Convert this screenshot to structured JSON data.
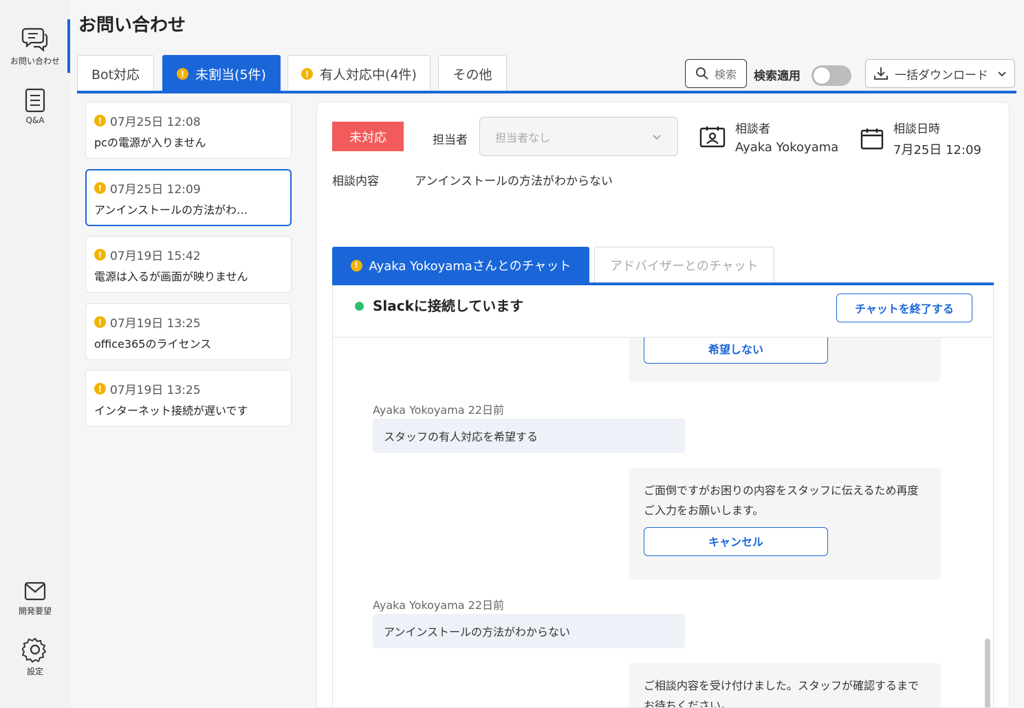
{
  "rail": {
    "items": [
      {
        "label": "お問い合わせ",
        "icon": "chat-bubbles-icon"
      },
      {
        "label": "Q&A",
        "icon": "document-list-icon"
      },
      {
        "label": "開発要望",
        "icon": "mail-icon"
      },
      {
        "label": "設定",
        "icon": "gear-icon"
      }
    ]
  },
  "page": {
    "title": "お問い合わせ"
  },
  "tabs": [
    {
      "label": "Bot対応"
    },
    {
      "label": "未割当(5件)"
    },
    {
      "label": "有人対応中(4件)"
    },
    {
      "label": "その他"
    }
  ],
  "toolbar": {
    "search_label": "検索",
    "search_apply_label": "検索適用",
    "download_label": "一括ダウンロード"
  },
  "inquiries": [
    {
      "time": "07月25日 12:08",
      "title": "pcの電源が入りません"
    },
    {
      "time": "07月25日 12:09",
      "title": "アンインストールの方法がわ…"
    },
    {
      "time": "07月19日 15:42",
      "title": "電源は入るが画面が映りません"
    },
    {
      "time": "07月19日 13:25",
      "title": "office365のライセンス"
    },
    {
      "time": "07月19日 13:25",
      "title": "インターネット接続が遅いです"
    }
  ],
  "detail": {
    "status": "未対応",
    "assignee_label": "担当者",
    "assignee_placeholder": "担当者なし",
    "consulter_label": "相談者",
    "consulter_name": "Ayaka Yokoyama",
    "date_label": "相談日時",
    "date_value": "7月25日 12:09",
    "consult_label": "相談内容",
    "consult_value": "アンインストールの方法がわからない"
  },
  "chat": {
    "tab_user": "Ayaka Yokoyamaさんとのチャット",
    "tab_advisor": "アドバイザーとのチャット",
    "connected": "Slackに接続しています",
    "end_button": "チャットを終了する",
    "messages": {
      "bot1_button": "希望しない",
      "user1_meta": "Ayaka Yokoyama 22日前",
      "user1_text": "スタッフの有人対応を希望する",
      "bot2_text": "ご面倒ですがお困りの内容をスタッフに伝えるため再度ご入力をお願いします。",
      "bot2_button": "キャンセル",
      "user2_meta": "Ayaka Yokoyama 22日前",
      "user2_text": "アンインストールの方法がわからない",
      "bot3_text": "ご相談内容を受け付けました。スタッフが確認するまでお待ちください。"
    }
  },
  "colors": {
    "accent": "#1a66d9",
    "status_red": "#f25b5b",
    "warn_yellow": "#f2b300",
    "online_green": "#2fbf71"
  }
}
